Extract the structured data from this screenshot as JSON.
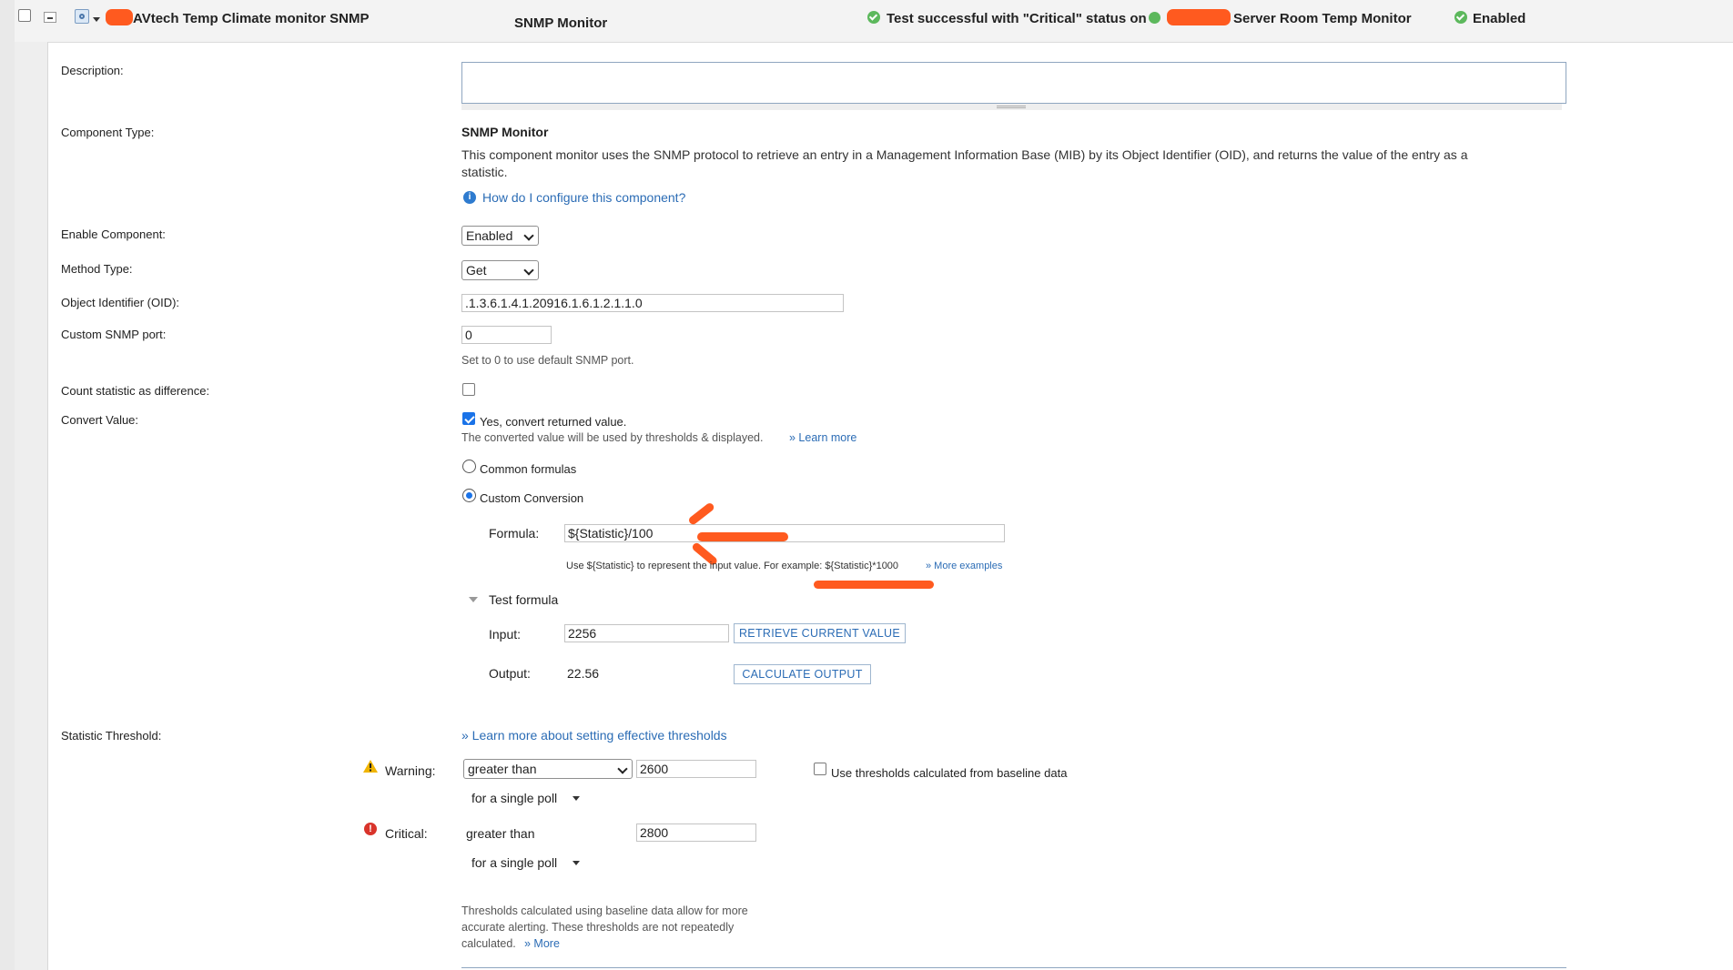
{
  "header": {
    "app_name": "AVtech Temp Climate monitor SNMP",
    "monitor_type": "SNMP Monitor",
    "test_status": "Test successful with \"Critical\" status on",
    "node_suffix": "Server Room Temp Monitor",
    "enabled_status": "Enabled"
  },
  "form": {
    "description_label": "Description:",
    "description_value": "",
    "component_type_label": "Component Type:",
    "component_type_title": "SNMP Monitor",
    "component_type_desc_line1": "This component monitor uses the SNMP protocol to retrieve an entry in a Management Information Base (MIB) by its Object Identifier (OID), and returns the value of the entry as a",
    "component_type_desc_line2": "statistic.",
    "help_link": "How do I configure this component?",
    "enable_label": "Enable Component:",
    "enable_value": "Enabled",
    "method_label": "Method Type:",
    "method_value": "Get",
    "oid_label": "Object Identifier (OID):",
    "oid_value": ".1.3.6.1.4.1.20916.1.6.1.2.1.1.0",
    "port_label": "Custom SNMP port:",
    "port_value": "0",
    "port_hint": "Set to 0 to use default SNMP port.",
    "count_diff_label": "Count statistic as difference:",
    "count_diff_checked": false,
    "convert_label": "Convert Value:",
    "convert_checkbox_label": "Yes, convert returned value.",
    "convert_checked": true,
    "convert_hint": "The converted value will be used by thresholds & displayed.",
    "convert_learn_more": "» Learn more",
    "radio_common": "Common formulas",
    "radio_custom": "Custom Conversion",
    "formula_label": "Formula:",
    "formula_value": "${Statistic}/100",
    "formula_hint": "Use ${Statistic} to represent the input value. For example: ${Statistic}*1000",
    "formula_more": "» More examples",
    "test_formula_label": "Test formula",
    "input_label": "Input:",
    "input_value": "2256",
    "retrieve_button": "RETRIEVE CURRENT VALUE",
    "output_label": "Output:",
    "output_value": "22.56",
    "calculate_button": "CALCULATE OUTPUT"
  },
  "thresholds": {
    "label": "Statistic Threshold:",
    "learn_more": "» Learn more about setting effective thresholds",
    "warning_label": "Warning:",
    "warning_operator": "greater than",
    "warning_value": "2600",
    "warning_poll": "for  a single poll",
    "baseline_label": "Use thresholds calculated from baseline data",
    "baseline_checked": false,
    "critical_label": "Critical:",
    "critical_operator": "greater than",
    "critical_value": "2800",
    "critical_poll": "for  a single poll",
    "baseline_note_line1": "Thresholds calculated using baseline data allow for more",
    "baseline_note_line2": "accurate alerting. These thresholds are not repeatedly",
    "baseline_note_line3": "calculated.",
    "baseline_note_more": "» More"
  },
  "colors": {
    "accent_blue": "#2b6cb5",
    "success_green": "#5cb85c",
    "annotation_orange": "#ff5a1f",
    "warning_yellow": "#f0b400",
    "critical_red": "#d9342b"
  },
  "icons": [
    "checkbox-icon",
    "collapse-icon",
    "component-icon",
    "check-circle-icon",
    "status-dot-icon",
    "info-icon",
    "warning-icon",
    "critical-icon",
    "expand-triangle-icon",
    "dropdown-caret-icon"
  ]
}
